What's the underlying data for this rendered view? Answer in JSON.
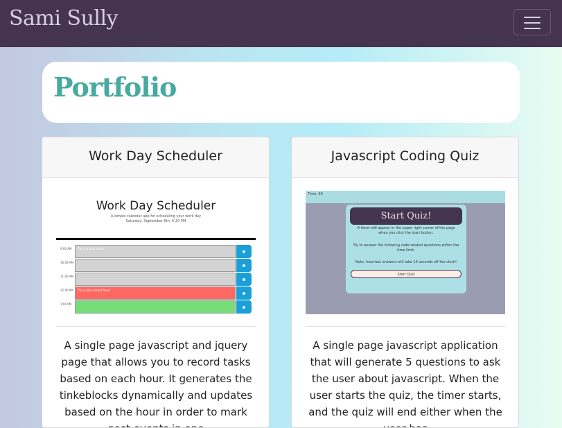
{
  "nav": {
    "brand": "Sami Sully",
    "toggle_icon": "hamburger-icon"
  },
  "jumbotron": {
    "title": "Portfolio"
  },
  "projects": [
    {
      "title": "Work Day Scheduler",
      "preview": {
        "heading": "Work Day Scheduler",
        "subtitle": "A simple calendar app for scheduling your work day",
        "date": "Saturday, September 6th, 5:20 PM",
        "rows": [
          {
            "hour": "9:00 AM",
            "text": "This is a past event",
            "state": "past"
          },
          {
            "hour": "10:00 AM",
            "text": "",
            "state": "past"
          },
          {
            "hour": "11:00 AM",
            "text": "",
            "state": "past"
          },
          {
            "hour": "12:00 PM",
            "text": "This is the current hour!",
            "state": "present"
          },
          {
            "hour": "1:00 PM",
            "text": "",
            "state": "future"
          }
        ],
        "colors": {
          "past": "#d3d3d3",
          "present": "#ff6961",
          "future": "#77dd77"
        }
      },
      "description": "A single page javascript and jquery page that allows you to record tasks based on each hour. It generates the tinkeblocks dynamically and updates based on the hour in order to mark past events in one"
    },
    {
      "title": "Javascript Coding Quiz",
      "preview": {
        "timer": "Time: 60",
        "heading": "Start Quiz!",
        "p1": "A timer will appear in the upper right corner of the page when you click the start button.",
        "p2": "Try to answer the following code-related questions within the time limit.",
        "p3": "Note: incorrect answers will take 10 seconds off the clock!",
        "button": "Start Quiz"
      },
      "description": "A single page javascript application that will generate 5 questions to ask the user about javascript. When the user starts the quiz, the timer starts, and the quiz will end either when the user has"
    }
  ]
}
